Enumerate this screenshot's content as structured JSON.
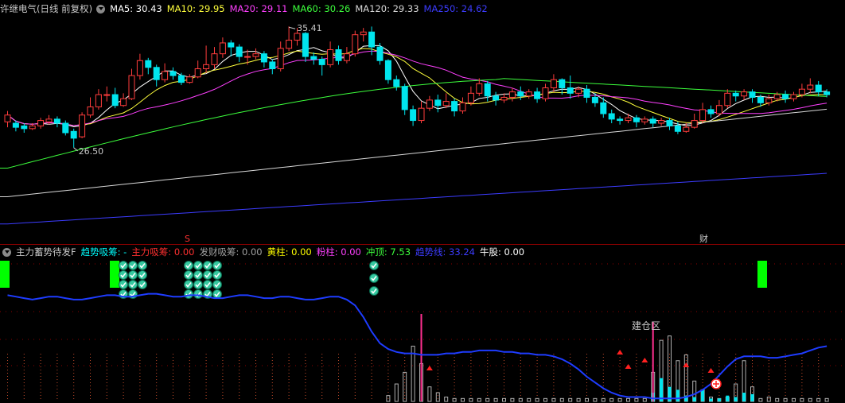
{
  "header": {
    "title": "许继电气(日线 前复权)",
    "ma": [
      {
        "label": "MA5: 30.43",
        "color": "#ffffff"
      },
      {
        "label": "MA10: 29.95",
        "color": "#ffff3c"
      },
      {
        "label": "MA20: 29.11",
        "color": "#ff40ff"
      },
      {
        "label": "MA60: 30.26",
        "color": "#3cff3c"
      },
      {
        "label": "MA120: 29.33",
        "color": "#d8d8d8"
      },
      {
        "label": "MA250: 24.62",
        "color": "#3c3cff"
      }
    ]
  },
  "indicator": {
    "title": "主力蓄势待发F",
    "items": [
      {
        "label": "趋势吸筹: -",
        "color": "#00ffff"
      },
      {
        "label": "主力吸筹: 0.00",
        "color": "#ff3030"
      },
      {
        "label": "发财吸筹: 0.00",
        "color": "#a0a0a0"
      },
      {
        "label": "黄柱: 0.00",
        "color": "#ffff00"
      },
      {
        "label": "粉柱: 0.00",
        "color": "#ff40ff"
      },
      {
        "label": "冲顶: 7.53",
        "color": "#3cff3c"
      },
      {
        "label": "趋势线: 33.24",
        "color": "#3c3cff"
      },
      {
        "label": "牛股: 0.00",
        "color": "#ffffff"
      }
    ],
    "zone_label": "建仓区"
  },
  "annotations": {
    "high": "35.41",
    "low": "26.50",
    "s_marker": "S",
    "fin_marker": "财"
  },
  "chart_data": [
    {
      "type": "candlestick",
      "title": "许继电气(日线 前复权)",
      "x": [
        0,
        1,
        2,
        3,
        4,
        5,
        6,
        7,
        8,
        9,
        10,
        11,
        12,
        13,
        14,
        15,
        16,
        17,
        18,
        19,
        20,
        21,
        22,
        23,
        24,
        25,
        26,
        27,
        28,
        29,
        30,
        31,
        32,
        33,
        34,
        35,
        36,
        37,
        38,
        39,
        40,
        41,
        42,
        43,
        44,
        45,
        46,
        47,
        48,
        49,
        50,
        51,
        52,
        53,
        54,
        55,
        56,
        57,
        58,
        59,
        60,
        61,
        62,
        63,
        64,
        65,
        66,
        67,
        68,
        69,
        70,
        71,
        72,
        73,
        74,
        75,
        76,
        77,
        78,
        79,
        80,
        81,
        82,
        83,
        84,
        85,
        86,
        87,
        88,
        89,
        90,
        91,
        92,
        93,
        94,
        95,
        96,
        97,
        98,
        99
      ],
      "candles": [
        [
          28.4,
          28.9,
          28.0,
          29.2
        ],
        [
          28.3,
          28.0,
          27.7,
          28.5
        ],
        [
          28.1,
          27.9,
          27.6,
          28.3
        ],
        [
          27.9,
          28.1,
          27.8,
          28.3
        ],
        [
          28.1,
          28.5,
          27.9,
          28.7
        ],
        [
          28.4,
          28.6,
          28.2,
          28.9
        ],
        [
          28.6,
          28.3,
          28.0,
          28.8
        ],
        [
          28.3,
          27.6,
          27.4,
          28.5
        ],
        [
          27.7,
          27.2,
          26.5,
          27.9
        ],
        [
          27.3,
          28.9,
          27.2,
          29.1
        ],
        [
          28.9,
          29.5,
          28.7,
          30.2
        ],
        [
          29.5,
          30.4,
          29.3,
          30.8
        ],
        [
          30.4,
          30.4,
          29.9,
          31.0
        ],
        [
          30.4,
          29.6,
          29.4,
          30.9
        ],
        [
          29.6,
          30.1,
          29.5,
          30.5
        ],
        [
          30.1,
          31.8,
          30.0,
          32.3
        ],
        [
          31.8,
          32.9,
          31.5,
          33.4
        ],
        [
          32.9,
          32.4,
          31.9,
          33.1
        ],
        [
          32.4,
          31.5,
          31.0,
          32.6
        ],
        [
          31.5,
          32.1,
          31.3,
          32.7
        ],
        [
          32.1,
          31.8,
          31.5,
          32.4
        ],
        [
          31.8,
          31.3,
          31.1,
          32.0
        ],
        [
          31.3,
          31.7,
          31.2,
          31.9
        ],
        [
          31.7,
          32.3,
          31.6,
          32.9
        ],
        [
          32.3,
          32.6,
          32.0,
          34.0
        ],
        [
          32.6,
          33.4,
          32.3,
          33.9
        ],
        [
          33.4,
          34.2,
          33.1,
          34.6
        ],
        [
          34.2,
          33.9,
          33.2,
          34.4
        ],
        [
          33.9,
          33.2,
          32.8,
          34.1
        ],
        [
          33.2,
          33.2,
          32.6,
          33.7
        ],
        [
          33.2,
          33.4,
          33.0,
          33.8
        ],
        [
          33.4,
          32.8,
          32.4,
          33.6
        ],
        [
          32.8,
          32.3,
          31.9,
          33.0
        ],
        [
          32.3,
          33.8,
          32.1,
          34.3
        ],
        [
          33.8,
          34.4,
          33.6,
          35.41
        ],
        [
          34.4,
          34.9,
          34.0,
          35.3
        ],
        [
          34.9,
          33.2,
          32.8,
          35.0
        ],
        [
          33.2,
          33.0,
          32.6,
          33.5
        ],
        [
          33.0,
          32.6,
          31.8,
          33.2
        ],
        [
          32.6,
          33.7,
          32.4,
          34.3
        ],
        [
          33.7,
          32.9,
          32.6,
          34.0
        ],
        [
          32.9,
          33.4,
          32.7,
          33.9
        ],
        [
          33.4,
          34.8,
          33.2,
          35.1
        ],
        [
          34.8,
          35.0,
          34.3,
          35.3
        ],
        [
          35.0,
          33.9,
          33.3,
          35.4
        ],
        [
          33.9,
          32.9,
          32.6,
          34.2
        ],
        [
          32.9,
          31.5,
          31.2,
          33.0
        ],
        [
          31.5,
          31.0,
          30.7,
          31.8
        ],
        [
          31.0,
          29.3,
          28.9,
          31.2
        ],
        [
          29.3,
          28.5,
          28.1,
          29.6
        ],
        [
          28.5,
          29.4,
          28.3,
          29.9
        ],
        [
          29.4,
          30.0,
          29.2,
          30.3
        ],
        [
          30.0,
          29.6,
          29.1,
          30.4
        ],
        [
          29.6,
          29.9,
          29.4,
          30.5
        ],
        [
          29.9,
          29.2,
          28.8,
          30.1
        ],
        [
          29.2,
          29.8,
          29.0,
          30.2
        ],
        [
          29.8,
          30.5,
          29.6,
          31.0
        ],
        [
          30.5,
          31.2,
          30.3,
          31.6
        ],
        [
          31.2,
          30.3,
          29.9,
          31.4
        ],
        [
          30.3,
          30.0,
          29.6,
          30.6
        ],
        [
          30.0,
          30.2,
          29.8,
          30.5
        ],
        [
          30.2,
          30.6,
          29.9,
          30.9
        ],
        [
          30.6,
          30.3,
          30.0,
          31.0
        ],
        [
          30.3,
          30.6,
          30.1,
          30.8
        ],
        [
          30.6,
          30.1,
          29.8,
          30.9
        ],
        [
          30.1,
          30.9,
          29.9,
          31.2
        ],
        [
          30.9,
          31.5,
          30.6,
          31.9
        ],
        [
          31.5,
          30.9,
          30.4,
          31.6
        ],
        [
          30.9,
          30.5,
          30.1,
          31.8
        ],
        [
          30.5,
          30.8,
          30.2,
          31.0
        ],
        [
          30.8,
          30.2,
          29.8,
          31.1
        ],
        [
          30.2,
          29.8,
          29.5,
          30.5
        ],
        [
          29.8,
          29.0,
          28.7,
          30.2
        ],
        [
          29.0,
          28.6,
          28.3,
          29.3
        ],
        [
          28.6,
          28.5,
          28.2,
          28.8
        ],
        [
          28.5,
          28.7,
          28.3,
          29.0
        ],
        [
          28.7,
          28.4,
          28.0,
          28.9
        ],
        [
          28.4,
          28.6,
          28.2,
          28.8
        ],
        [
          28.6,
          28.3,
          28.0,
          28.8
        ],
        [
          28.3,
          28.5,
          28.1,
          28.7
        ],
        [
          28.5,
          28.1,
          27.8,
          28.7
        ],
        [
          28.1,
          27.7,
          27.5,
          28.4
        ],
        [
          27.7,
          28.0,
          27.6,
          28.3
        ],
        [
          28.0,
          28.5,
          27.9,
          29.0
        ],
        [
          28.5,
          29.3,
          28.3,
          29.8
        ],
        [
          29.3,
          29.0,
          28.7,
          29.6
        ],
        [
          29.0,
          29.6,
          28.8,
          30.0
        ],
        [
          29.6,
          30.5,
          29.4,
          30.8
        ],
        [
          30.5,
          30.3,
          29.9,
          30.7
        ],
        [
          30.3,
          30.6,
          30.0,
          30.8
        ],
        [
          30.6,
          30.2,
          29.8,
          30.8
        ],
        [
          30.2,
          29.8,
          29.5,
          30.4
        ],
        [
          29.8,
          30.1,
          29.6,
          30.4
        ],
        [
          30.1,
          30.4,
          29.9,
          30.6
        ],
        [
          30.4,
          30.1,
          29.8,
          30.7
        ],
        [
          30.1,
          30.4,
          29.9,
          30.6
        ],
        [
          30.4,
          30.8,
          30.2,
          31.2
        ],
        [
          30.8,
          31.1,
          30.5,
          31.6
        ],
        [
          31.1,
          30.6,
          30.3,
          31.4
        ],
        [
          30.6,
          30.4,
          30.2,
          30.8
        ]
      ],
      "ma_series": [
        {
          "name": "MA5",
          "color": "#ffffff"
        },
        {
          "name": "MA10",
          "color": "#ffff3c"
        },
        {
          "name": "MA20",
          "color": "#ff40ff"
        },
        {
          "name": "MA60",
          "color": "#3cff3c",
          "start": 25.0,
          "end": 30.26,
          "peak": 31.6
        },
        {
          "name": "MA120",
          "color": "#d8d8d8",
          "start": 22.9,
          "end": 29.33
        },
        {
          "name": "MA250",
          "color": "#3c3cff",
          "start": 20.9,
          "end": 24.62
        }
      ],
      "ylim": [
        20.3,
        36.3
      ]
    },
    {
      "type": "indicator",
      "title": "主力蓄势待发F",
      "trend_line": [
        73,
        72,
        71,
        70,
        71,
        72,
        72,
        71,
        70,
        70,
        71,
        72,
        73,
        73,
        72,
        72,
        73,
        74,
        74,
        73,
        72,
        72,
        73,
        73,
        72,
        71,
        71,
        72,
        73,
        73,
        72,
        71,
        71,
        72,
        72,
        71,
        70,
        70,
        71,
        72,
        72,
        70,
        66,
        58,
        48,
        40,
        36,
        34,
        33,
        33,
        32,
        32,
        32,
        33,
        33,
        34,
        34,
        35,
        35,
        35,
        34,
        34,
        33,
        33,
        32,
        32,
        31,
        29,
        26,
        22,
        17,
        13,
        9,
        6,
        4,
        3,
        3,
        3,
        2,
        2,
        2,
        2,
        3,
        5,
        8,
        12,
        18,
        24,
        29,
        31,
        31,
        31,
        30,
        30,
        31,
        32,
        33,
        35,
        37,
        38
      ],
      "vol_bars": [
        0,
        0,
        0,
        0,
        0,
        0,
        0,
        0,
        0,
        0,
        0,
        0,
        0,
        0,
        0,
        0,
        0,
        0,
        0,
        0,
        0,
        0,
        0,
        0,
        0,
        0,
        0,
        0,
        0,
        0,
        0,
        0,
        0,
        0,
        0,
        0,
        0,
        0,
        0,
        0,
        0,
        0,
        0,
        0,
        0,
        0,
        4,
        12,
        20,
        38,
        26,
        10,
        6,
        3,
        2,
        2,
        2,
        2,
        2,
        2,
        2,
        2,
        2,
        2,
        2,
        2,
        2,
        2,
        2,
        2,
        2,
        2,
        2,
        2,
        2,
        2,
        2,
        2,
        20,
        42,
        45,
        28,
        32,
        14,
        8,
        3,
        2,
        3,
        12,
        28,
        10,
        2,
        3,
        2,
        2,
        2,
        2,
        2,
        2,
        2
      ],
      "cyan_bars": [
        0,
        0,
        0,
        0,
        0,
        0,
        0,
        0,
        0,
        0,
        0,
        0,
        0,
        0,
        0,
        0,
        0,
        0,
        0,
        0,
        0,
        0,
        0,
        0,
        0,
        0,
        0,
        0,
        0,
        0,
        0,
        0,
        0,
        0,
        0,
        0,
        0,
        0,
        0,
        0,
        0,
        0,
        0,
        0,
        0,
        0,
        0,
        0,
        0,
        0,
        0,
        0,
        0,
        0,
        0,
        0,
        0,
        0,
        0,
        0,
        0,
        0,
        0,
        0,
        0,
        0,
        0,
        0,
        0,
        0,
        0,
        0,
        0,
        0,
        0,
        0,
        0,
        0,
        6,
        16,
        10,
        8,
        4,
        3,
        8,
        2,
        2,
        4,
        3,
        6,
        5,
        0,
        0,
        0,
        0,
        0,
        0,
        0,
        0,
        0
      ],
      "ylim": [
        0,
        100
      ]
    }
  ]
}
